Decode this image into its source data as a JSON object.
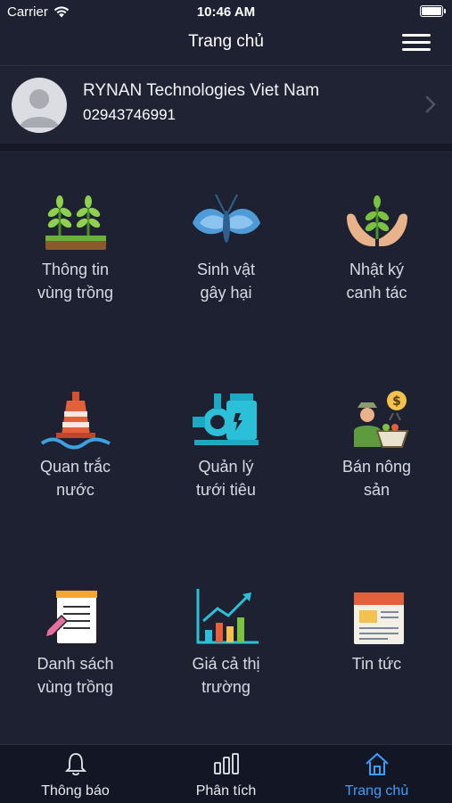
{
  "status_bar": {
    "carrier": "Carrier",
    "time": "10:46 AM",
    "icons": [
      "wifi-icon",
      "battery-icon"
    ]
  },
  "header": {
    "title": "Trang chủ",
    "menu_icon": "hamburger-menu-icon"
  },
  "profile": {
    "name": "RYNAN Technologies Viet Nam",
    "phone": "02943746991",
    "avatar_icon": "avatar-placeholder-icon",
    "chevron_icon": "chevron-right-icon"
  },
  "menu": [
    {
      "id": "crop-area-info",
      "line1": "Thông tin",
      "line2": "vùng trồng",
      "icon": "seedlings-icon"
    },
    {
      "id": "pests",
      "line1": "Sinh vật",
      "line2": "gây hại",
      "icon": "moth-icon"
    },
    {
      "id": "farming-diary",
      "line1": "Nhật ký",
      "line2": "canh tác",
      "icon": "hands-plant-icon"
    },
    {
      "id": "water-monitoring",
      "line1": "Quan trắc",
      "line2": "nước",
      "icon": "buoy-icon"
    },
    {
      "id": "irrigation",
      "line1": "Quản lý",
      "line2": "tưới tiêu",
      "icon": "water-pump-icon"
    },
    {
      "id": "sell-produce",
      "line1": "Bán nông",
      "line2": "sản",
      "icon": "farmer-seller-icon"
    },
    {
      "id": "crop-area-list",
      "line1": "Danh sách",
      "line2": "vùng trồng",
      "icon": "notepad-icon"
    },
    {
      "id": "market-prices",
      "line1": "Giá cả thị",
      "line2": "trường",
      "icon": "growth-chart-icon"
    },
    {
      "id": "news",
      "line1": "Tin tức",
      "line2": "",
      "icon": "newspaper-icon"
    }
  ],
  "tab_bar": {
    "tabs": [
      {
        "label": "Thông báo",
        "icon": "bell-icon",
        "active": false
      },
      {
        "label": "Phân tích",
        "icon": "bar-chart-icon",
        "active": false
      },
      {
        "label": "Trang chủ",
        "icon": "home-icon",
        "active": true
      }
    ]
  },
  "colors": {
    "background": "#1d2131",
    "tab_active": "#3a9fff",
    "text": "#d8dbe3"
  }
}
